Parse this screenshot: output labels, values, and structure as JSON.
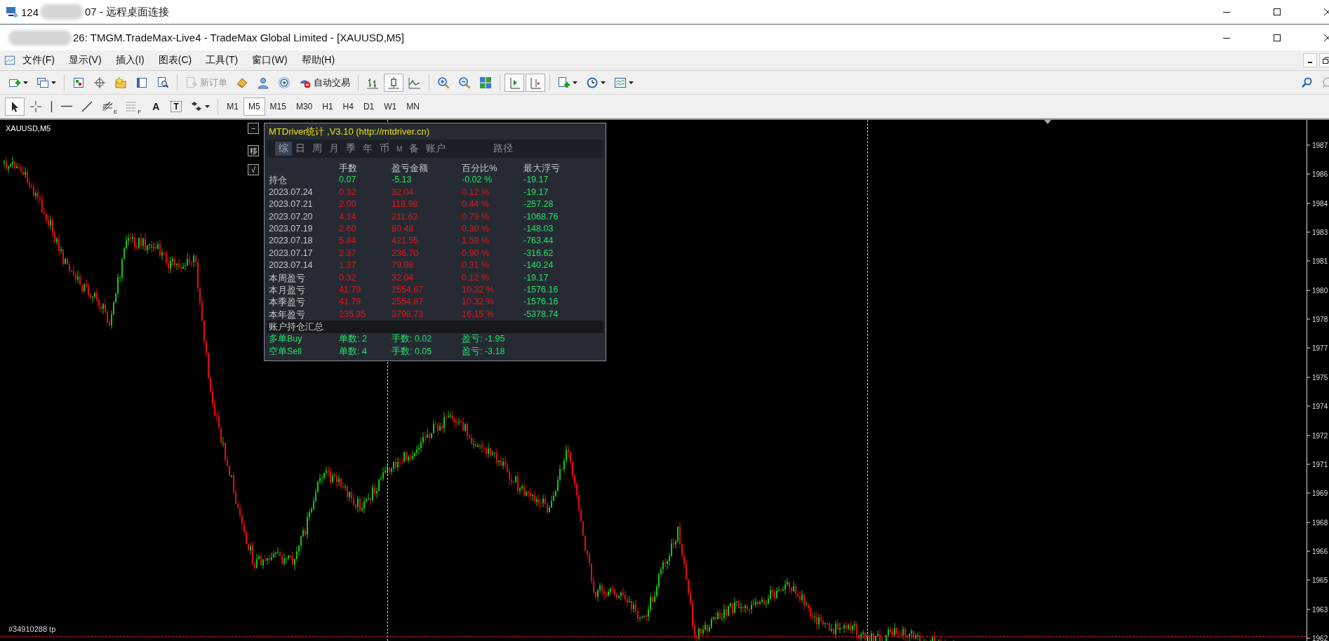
{
  "remote_window": {
    "title_start": "124",
    "title_end": "07 - 远程桌面连接"
  },
  "app_window": {
    "title": "26: TMGM.TradeMax-Live4 - TradeMax Global Limited - [XAUUSD,M5]"
  },
  "menu": [
    "文件(F)",
    "显示(V)",
    "插入(I)",
    "图表(C)",
    "工具(T)",
    "窗口(W)",
    "帮助(H)"
  ],
  "toolbar": [
    {
      "kind": "dropdown",
      "on": false,
      "disabled": false
    },
    {
      "kind": "dropdown",
      "on": false,
      "disabled": false
    },
    {
      "kind": "separator"
    },
    {
      "kind": "button",
      "on": false,
      "disabled": false
    },
    {
      "kind": "button",
      "on": false,
      "disabled": false
    },
    {
      "kind": "button",
      "on": false,
      "disabled": false
    },
    {
      "kind": "button",
      "on": false,
      "disabled": false
    },
    {
      "kind": "button",
      "on": false,
      "disabled": false
    },
    {
      "kind": "separator"
    },
    {
      "kind": "button",
      "label": "新订单",
      "on": false,
      "disabled": true
    },
    {
      "kind": "button",
      "on": false,
      "disabled": false
    },
    {
      "kind": "button",
      "on": false,
      "disabled": false
    },
    {
      "kind": "button",
      "on": false,
      "disabled": false
    },
    {
      "kind": "button",
      "label": "自动交易",
      "on": false,
      "disabled": false
    },
    {
      "kind": "separator"
    },
    {
      "kind": "button",
      "on": false,
      "disabled": false
    },
    {
      "kind": "button",
      "on": true,
      "disabled": false
    },
    {
      "kind": "button",
      "on": false,
      "disabled": false
    },
    {
      "kind": "separator"
    },
    {
      "kind": "button",
      "on": false,
      "disabled": false
    },
    {
      "kind": "button",
      "on": false,
      "disabled": false
    },
    {
      "kind": "button",
      "on": false,
      "disabled": false
    },
    {
      "kind": "separator"
    },
    {
      "kind": "button",
      "on": true,
      "disabled": false
    },
    {
      "kind": "button",
      "on": true,
      "disabled": false
    },
    {
      "kind": "separator"
    },
    {
      "kind": "dropdown",
      "on": false,
      "disabled": false
    },
    {
      "kind": "dropdown",
      "on": false,
      "disabled": false
    },
    {
      "kind": "dropdown",
      "on": false,
      "disabled": false
    }
  ],
  "tools": [
    {
      "selected": true
    },
    {
      "selected": false
    },
    {
      "selected": false
    },
    {
      "selected": false
    },
    {
      "selected": false
    },
    {
      "selected": false,
      "sub": "E"
    },
    {
      "selected": false,
      "sub": "F"
    },
    {
      "selected": false,
      "label": "A"
    },
    {
      "selected": false,
      "label": "T"
    },
    {
      "selected": false
    }
  ],
  "periods": [
    {
      "label": "M1",
      "selected": false
    },
    {
      "label": "M5",
      "selected": true
    },
    {
      "label": "M15",
      "selected": false
    },
    {
      "label": "M30",
      "selected": false
    },
    {
      "label": "H1",
      "selected": false
    },
    {
      "label": "H4",
      "selected": false
    },
    {
      "label": "D1",
      "selected": false
    },
    {
      "label": "W1",
      "selected": false
    },
    {
      "label": "MN",
      "selected": false
    }
  ],
  "chart": {
    "symbol": "XAUUSD,M5",
    "order_label": "#34910288 tp",
    "side_buttons": [
      "−",
      "移",
      "√"
    ],
    "price_axis": [
      "1987",
      "1986",
      "1984",
      "1983",
      "1981",
      "1980",
      "1978",
      "1977",
      "1975",
      "1974",
      "1972",
      "1971",
      "1969",
      "1968",
      "1966",
      "1965",
      "1963",
      "1962"
    ]
  },
  "stats_panel": {
    "title": "MTDriver统计 ,V3.10 (http://mtdriver.cn)",
    "tabs": [
      {
        "label": "综",
        "selected": true
      },
      {
        "label": "日",
        "selected": false
      },
      {
        "label": "周",
        "selected": false
      },
      {
        "label": "月",
        "selected": false
      },
      {
        "label": "季",
        "selected": false
      },
      {
        "label": "年",
        "selected": false
      },
      {
        "label": "币",
        "selected": false
      },
      {
        "label": "M",
        "selected": false
      },
      {
        "label": "备",
        "selected": false
      },
      {
        "label": "账户",
        "selected": false
      },
      {
        "label": "路径",
        "selected": false
      }
    ],
    "columns": [
      "手数",
      "盈亏金额",
      "百分比%",
      "最大浮亏"
    ],
    "rows": [
      {
        "label": "持仓",
        "color": "#22e06a",
        "lots": "0.07",
        "profit": "-5.13",
        "percent": "-0.02 %",
        "max_drawdown": "-19.17"
      },
      {
        "label": "2023.07.24",
        "color": "#e0161e",
        "lots": "0.32",
        "profit": "32.04",
        "percent": "0.12 %",
        "max_drawdown": "-19.17"
      },
      {
        "label": "2023.07.21",
        "color": "#e0161e",
        "lots": "2.00",
        "profit": "118.98",
        "percent": "0.44 %",
        "max_drawdown": "-257.28"
      },
      {
        "label": "2023.07.20",
        "color": "#e0161e",
        "lots": "4.14",
        "profit": "211.62",
        "percent": "0.79 %",
        "max_drawdown": "-1068.76"
      },
      {
        "label": "2023.07.19",
        "color": "#e0161e",
        "lots": "2.60",
        "profit": "80.48",
        "percent": "0.30 %",
        "max_drawdown": "-148.03"
      },
      {
        "label": "2023.07.18",
        "color": "#e0161e",
        "lots": "5.84",
        "profit": "421.55",
        "percent": "1.59 %",
        "max_drawdown": "-763.44"
      },
      {
        "label": "2023.07.17",
        "color": "#e0161e",
        "lots": "2.37",
        "profit": "236.70",
        "percent": "0.90 %",
        "max_drawdown": "-316.62"
      },
      {
        "label": "2023.07.14",
        "color": "#e0161e",
        "lots": "1.37",
        "profit": "79.98",
        "percent": "0.31 %",
        "max_drawdown": "-140.24"
      },
      {
        "label": "本周盈亏",
        "color": "#e0161e",
        "lots": "0.32",
        "profit": "32.04",
        "percent": "0.12 %",
        "max_drawdown": "-19.17"
      },
      {
        "label": "本月盈亏",
        "color": "#e0161e",
        "lots": "41.79",
        "profit": "2554.87",
        "percent": "10.32 %",
        "max_drawdown": "-1576.16"
      },
      {
        "label": "本季盈亏",
        "color": "#e0161e",
        "lots": "41.79",
        "profit": "2554.87",
        "percent": "10.32 %",
        "max_drawdown": "-1576.16"
      },
      {
        "label": "本年盈亏",
        "color": "#e0161e",
        "lots": "235.35",
        "profit": "3798.73",
        "percent": "16.15 %",
        "max_drawdown": "-5378.74"
      }
    ],
    "summary_title": "账户持仓汇总",
    "summary": [
      {
        "side": "多单Buy",
        "orders": "单数: 2",
        "lots": "手数: 0.02",
        "profit": "盈亏: -1.95"
      },
      {
        "side": "空单Sell",
        "orders": "单数: 4",
        "lots": "手数: 0.05",
        "profit": "盈亏: -3.18"
      }
    ]
  }
}
